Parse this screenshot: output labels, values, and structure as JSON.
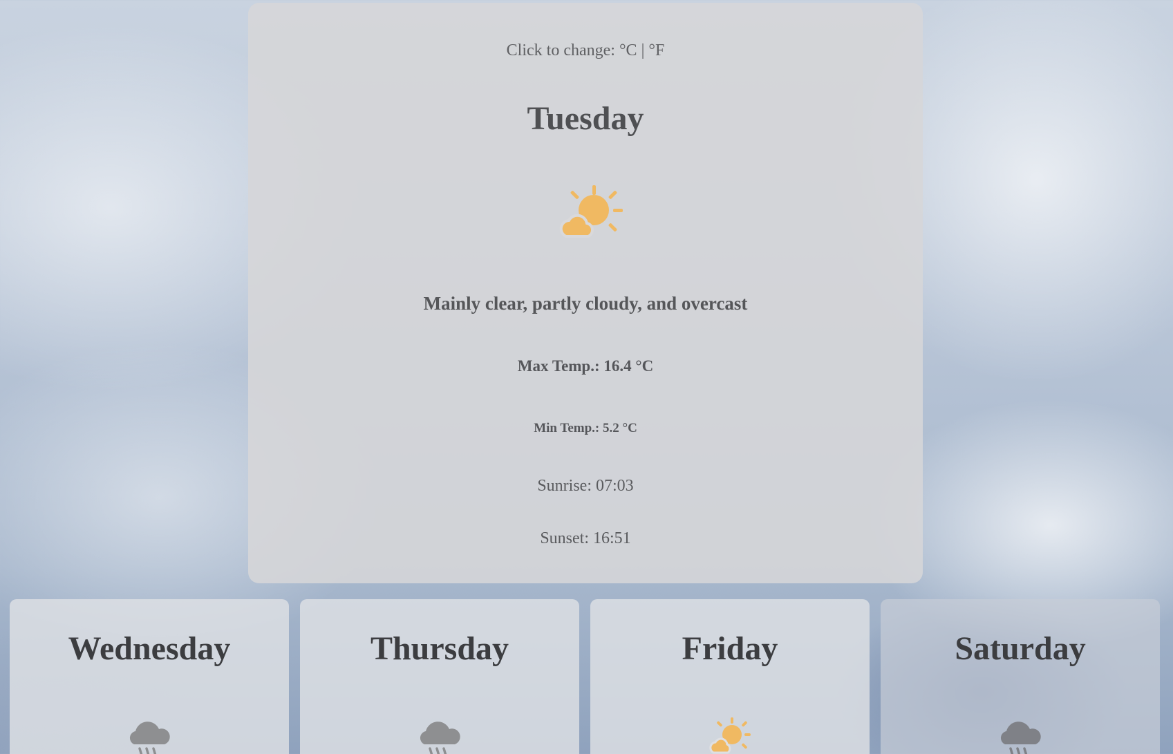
{
  "unit_toggle": "Click to change: °C | °F",
  "today": {
    "day": "Tuesday",
    "icon": "sun-behind-cloud-icon",
    "description": "Mainly clear, partly cloudy, and overcast",
    "max_temp": "Max Temp.: 16.4 °C",
    "min_temp": "Min Temp.: 5.2 °C",
    "sunrise": "Sunrise: 07:03",
    "sunset": "Sunset: 16:51"
  },
  "forecast": [
    {
      "day": "Wednesday",
      "icon": "rain-cloud-icon"
    },
    {
      "day": "Thursday",
      "icon": "rain-cloud-icon"
    },
    {
      "day": "Friday",
      "icon": "sun-behind-cloud-icon"
    },
    {
      "day": "Saturday",
      "icon": "rain-cloud-icon"
    }
  ],
  "colors": {
    "sun_icon": "#f0b962",
    "rain_icon": "#8e8f91",
    "text_dark": "#3c3d40",
    "text_muted": "#555659"
  }
}
